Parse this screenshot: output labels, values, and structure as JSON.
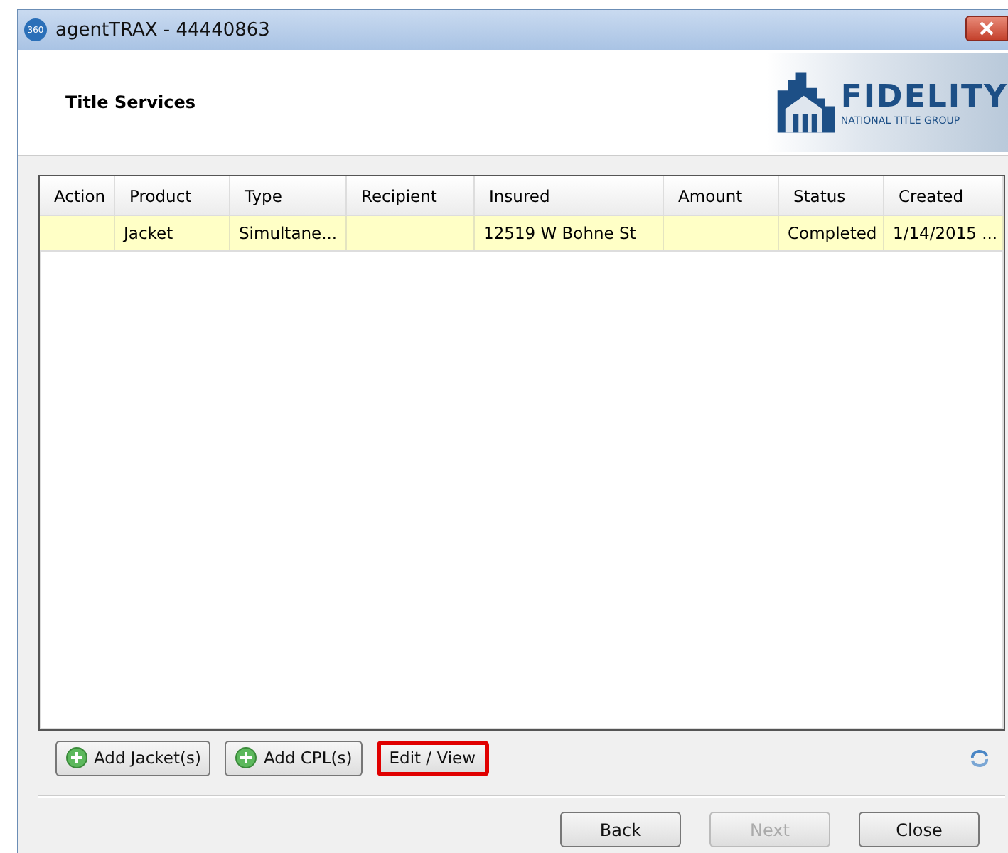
{
  "window": {
    "title": "agentTRAX - 44440863",
    "app_badge": "360"
  },
  "header": {
    "title": "Title Services",
    "logo": {
      "name": "FIDELITY",
      "tagline": "NATIONAL TITLE GROUP"
    }
  },
  "table": {
    "columns": [
      "Action",
      "Product",
      "Type",
      "Recipient",
      "Insured",
      "Amount",
      "Status",
      "Created"
    ],
    "rows": [
      {
        "selected": true,
        "cells": [
          "",
          "Jacket",
          "Simultane...",
          "",
          "12519 W Bohne St",
          "",
          "Completed",
          "1/14/2015 ..."
        ]
      }
    ]
  },
  "actions": [
    {
      "label": "Add Jacket(s)",
      "kind": "add",
      "highlighted": false
    },
    {
      "label": "Add CPL(s)",
      "kind": "add",
      "highlighted": false
    },
    {
      "label": "Edit / View",
      "kind": "plain",
      "highlighted": true
    }
  ],
  "nav_buttons": [
    {
      "label": "Back",
      "disabled": false
    },
    {
      "label": "Next",
      "disabled": true
    },
    {
      "label": "Close",
      "disabled": false
    }
  ]
}
